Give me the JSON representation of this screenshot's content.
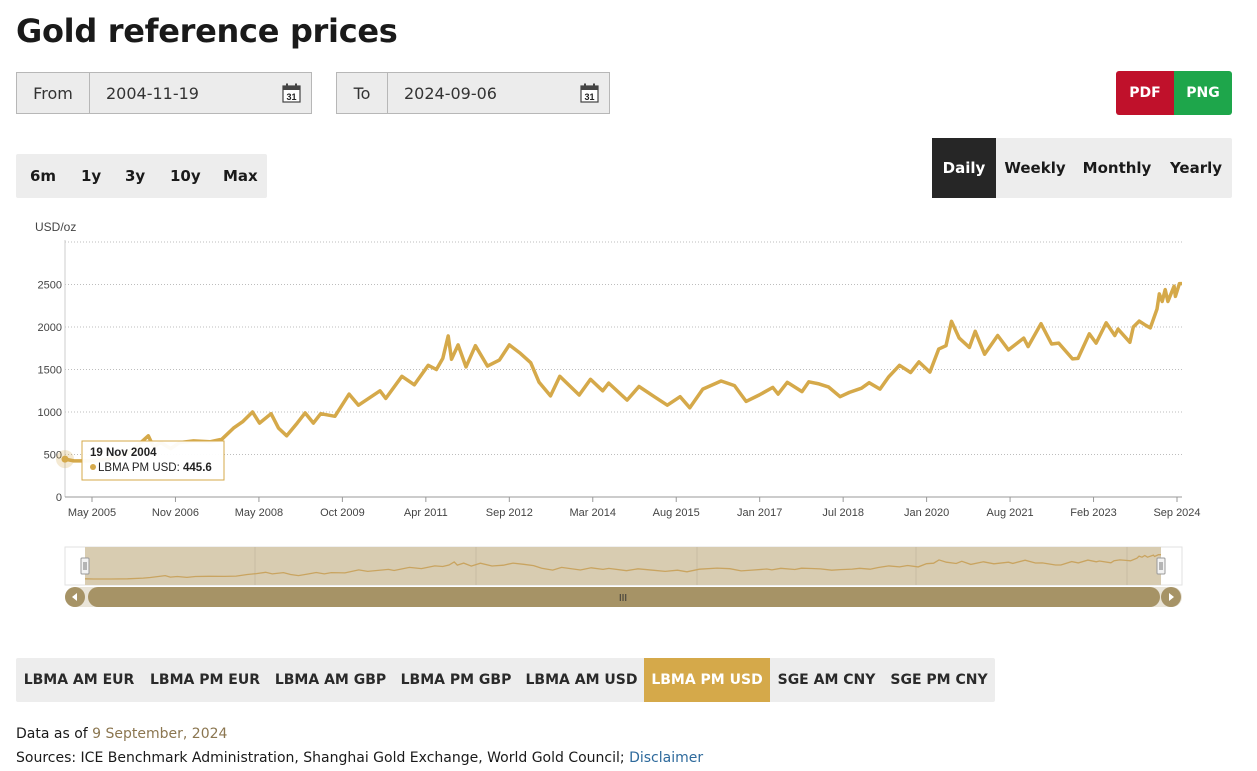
{
  "page": {
    "title": "Gold reference prices"
  },
  "filters": {
    "from_label": "From",
    "from_value": "2004-11-19",
    "to_label": "To",
    "to_value": "2024-09-06",
    "calendar_day": "31"
  },
  "export": {
    "pdf": "PDF",
    "png": "PNG",
    "pdf_color": "#c0112b",
    "png_color": "#1ea64b"
  },
  "ranges": [
    "6m",
    "1y",
    "3y",
    "10y",
    "Max"
  ],
  "frequency": {
    "options": [
      "Daily",
      "Weekly",
      "Monthly",
      "Yearly"
    ],
    "selected": "Daily"
  },
  "series_tabs": {
    "options": [
      "LBMA AM EUR",
      "LBMA PM EUR",
      "LBMA AM GBP",
      "LBMA PM GBP",
      "LBMA AM USD",
      "LBMA PM USD",
      "SGE AM CNY",
      "SGE PM CNY"
    ],
    "selected": "LBMA PM USD",
    "accent": "#d5a94a"
  },
  "tooltip": {
    "date": "19 Nov 2004",
    "series": "LBMA PM USD:",
    "value": "445.6"
  },
  "navigator": {
    "handle_glyph": "III"
  },
  "footer": {
    "data_as_of_label": "Data as of",
    "data_as_of_date": "9 September, 2024",
    "sources": "Sources: ICE Benchmark Administration, Shanghai Gold Exchange, World Gold Council;",
    "disclaimer": "Disclaimer"
  },
  "chart_data": {
    "type": "line",
    "ylabel": "USD/oz",
    "ylim": [
      0,
      3000
    ],
    "yticks": [
      0,
      500,
      1000,
      1500,
      2000,
      2500
    ],
    "grid": true,
    "line_color": "#d5a94a",
    "xticks": [
      "May 2005",
      "Nov 2006",
      "May 2008",
      "Oct 2009",
      "Apr 2011",
      "Sep 2012",
      "Mar 2014",
      "Aug 2015",
      "Jan 2017",
      "Jul 2018",
      "Jan 2020",
      "Aug 2021",
      "Feb 2023",
      "Sep 2024"
    ],
    "series": [
      {
        "values": [
          [
            "2004-11-19",
            445.6
          ],
          [
            "2005-01-15",
            425
          ],
          [
            "2005-05-15",
            425
          ],
          [
            "2005-09-01",
            445
          ],
          [
            "2005-12-15",
            505
          ],
          [
            "2006-02-01",
            555
          ],
          [
            "2006-05-12",
            720
          ],
          [
            "2006-06-15",
            590
          ],
          [
            "2006-08-01",
            640
          ],
          [
            "2006-10-05",
            570
          ],
          [
            "2006-12-01",
            640
          ],
          [
            "2007-03-01",
            660
          ],
          [
            "2007-06-15",
            650
          ],
          [
            "2007-09-01",
            680
          ],
          [
            "2007-11-15",
            810
          ],
          [
            "2008-01-15",
            890
          ],
          [
            "2008-03-17",
            1000
          ],
          [
            "2008-05-01",
            870
          ],
          [
            "2008-07-15",
            980
          ],
          [
            "2008-09-01",
            810
          ],
          [
            "2008-10-24",
            720
          ],
          [
            "2008-12-31",
            870
          ],
          [
            "2009-02-20",
            990
          ],
          [
            "2009-04-15",
            870
          ],
          [
            "2009-06-01",
            980
          ],
          [
            "2009-09-01",
            950
          ],
          [
            "2009-12-02",
            1210
          ],
          [
            "2010-02-01",
            1080
          ],
          [
            "2010-06-20",
            1250
          ],
          [
            "2010-07-28",
            1160
          ],
          [
            "2010-11-09",
            1420
          ],
          [
            "2011-01-28",
            1320
          ],
          [
            "2011-04-28",
            1550
          ],
          [
            "2011-06-20",
            1500
          ],
          [
            "2011-08-01",
            1630
          ],
          [
            "2011-09-05",
            1895
          ],
          [
            "2011-09-26",
            1620
          ],
          [
            "2011-11-08",
            1790
          ],
          [
            "2011-12-29",
            1530
          ],
          [
            "2012-02-28",
            1780
          ],
          [
            "2012-05-16",
            1540
          ],
          [
            "2012-08-01",
            1610
          ],
          [
            "2012-10-04",
            1790
          ],
          [
            "2012-12-15",
            1690
          ],
          [
            "2013-02-20",
            1580
          ],
          [
            "2013-04-15",
            1350
          ],
          [
            "2013-06-28",
            1190
          ],
          [
            "2013-08-27",
            1420
          ],
          [
            "2013-12-31",
            1200
          ],
          [
            "2014-03-14",
            1385
          ],
          [
            "2014-06-01",
            1250
          ],
          [
            "2014-07-10",
            1340
          ],
          [
            "2014-11-06",
            1140
          ],
          [
            "2015-01-22",
            1300
          ],
          [
            "2015-05-01",
            1180
          ],
          [
            "2015-07-24",
            1080
          ],
          [
            "2015-10-15",
            1180
          ],
          [
            "2015-12-17",
            1050
          ],
          [
            "2016-03-10",
            1270
          ],
          [
            "2016-07-06",
            1365
          ],
          [
            "2016-10-01",
            1310
          ],
          [
            "2016-12-15",
            1125
          ],
          [
            "2017-03-10",
            1200
          ],
          [
            "2017-06-06",
            1290
          ],
          [
            "2017-07-10",
            1210
          ],
          [
            "2017-09-08",
            1350
          ],
          [
            "2017-12-12",
            1240
          ],
          [
            "2018-01-25",
            1355
          ],
          [
            "2018-04-01",
            1330
          ],
          [
            "2018-06-01",
            1295
          ],
          [
            "2018-08-16",
            1180
          ],
          [
            "2018-10-15",
            1230
          ],
          [
            "2019-01-01",
            1280
          ],
          [
            "2019-02-20",
            1345
          ],
          [
            "2019-05-01",
            1270
          ],
          [
            "2019-06-25",
            1410
          ],
          [
            "2019-09-04",
            1550
          ],
          [
            "2019-11-15",
            1465
          ],
          [
            "2020-01-08",
            1590
          ],
          [
            "2020-03-19",
            1470
          ],
          [
            "2020-05-15",
            1740
          ],
          [
            "2020-07-01",
            1780
          ],
          [
            "2020-08-06",
            2067
          ],
          [
            "2020-09-25",
            1870
          ],
          [
            "2020-11-30",
            1760
          ],
          [
            "2021-01-06",
            1950
          ],
          [
            "2021-03-08",
            1680
          ],
          [
            "2021-06-01",
            1900
          ],
          [
            "2021-08-10",
            1730
          ],
          [
            "2021-11-16",
            1870
          ],
          [
            "2021-12-15",
            1770
          ],
          [
            "2022-03-08",
            2039
          ],
          [
            "2022-05-16",
            1800
          ],
          [
            "2022-07-01",
            1810
          ],
          [
            "2022-09-28",
            1625
          ],
          [
            "2022-11-03",
            1630
          ],
          [
            "2023-01-15",
            1920
          ],
          [
            "2023-02-28",
            1810
          ],
          [
            "2023-05-04",
            2050
          ],
          [
            "2023-06-29",
            1900
          ],
          [
            "2023-07-20",
            1975
          ],
          [
            "2023-10-05",
            1820
          ],
          [
            "2023-10-27",
            2000
          ],
          [
            "2023-12-04",
            2070
          ],
          [
            "2024-01-15",
            2020
          ],
          [
            "2024-02-14",
            1990
          ],
          [
            "2024-03-28",
            2210
          ],
          [
            "2024-04-12",
            2390
          ],
          [
            "2024-05-01",
            2300
          ],
          [
            "2024-05-20",
            2440
          ],
          [
            "2024-06-07",
            2300
          ],
          [
            "2024-07-17",
            2480
          ],
          [
            "2024-07-25",
            2360
          ],
          [
            "2024-08-20",
            2510
          ],
          [
            "2024-09-06",
            2510
          ]
        ]
      }
    ]
  }
}
